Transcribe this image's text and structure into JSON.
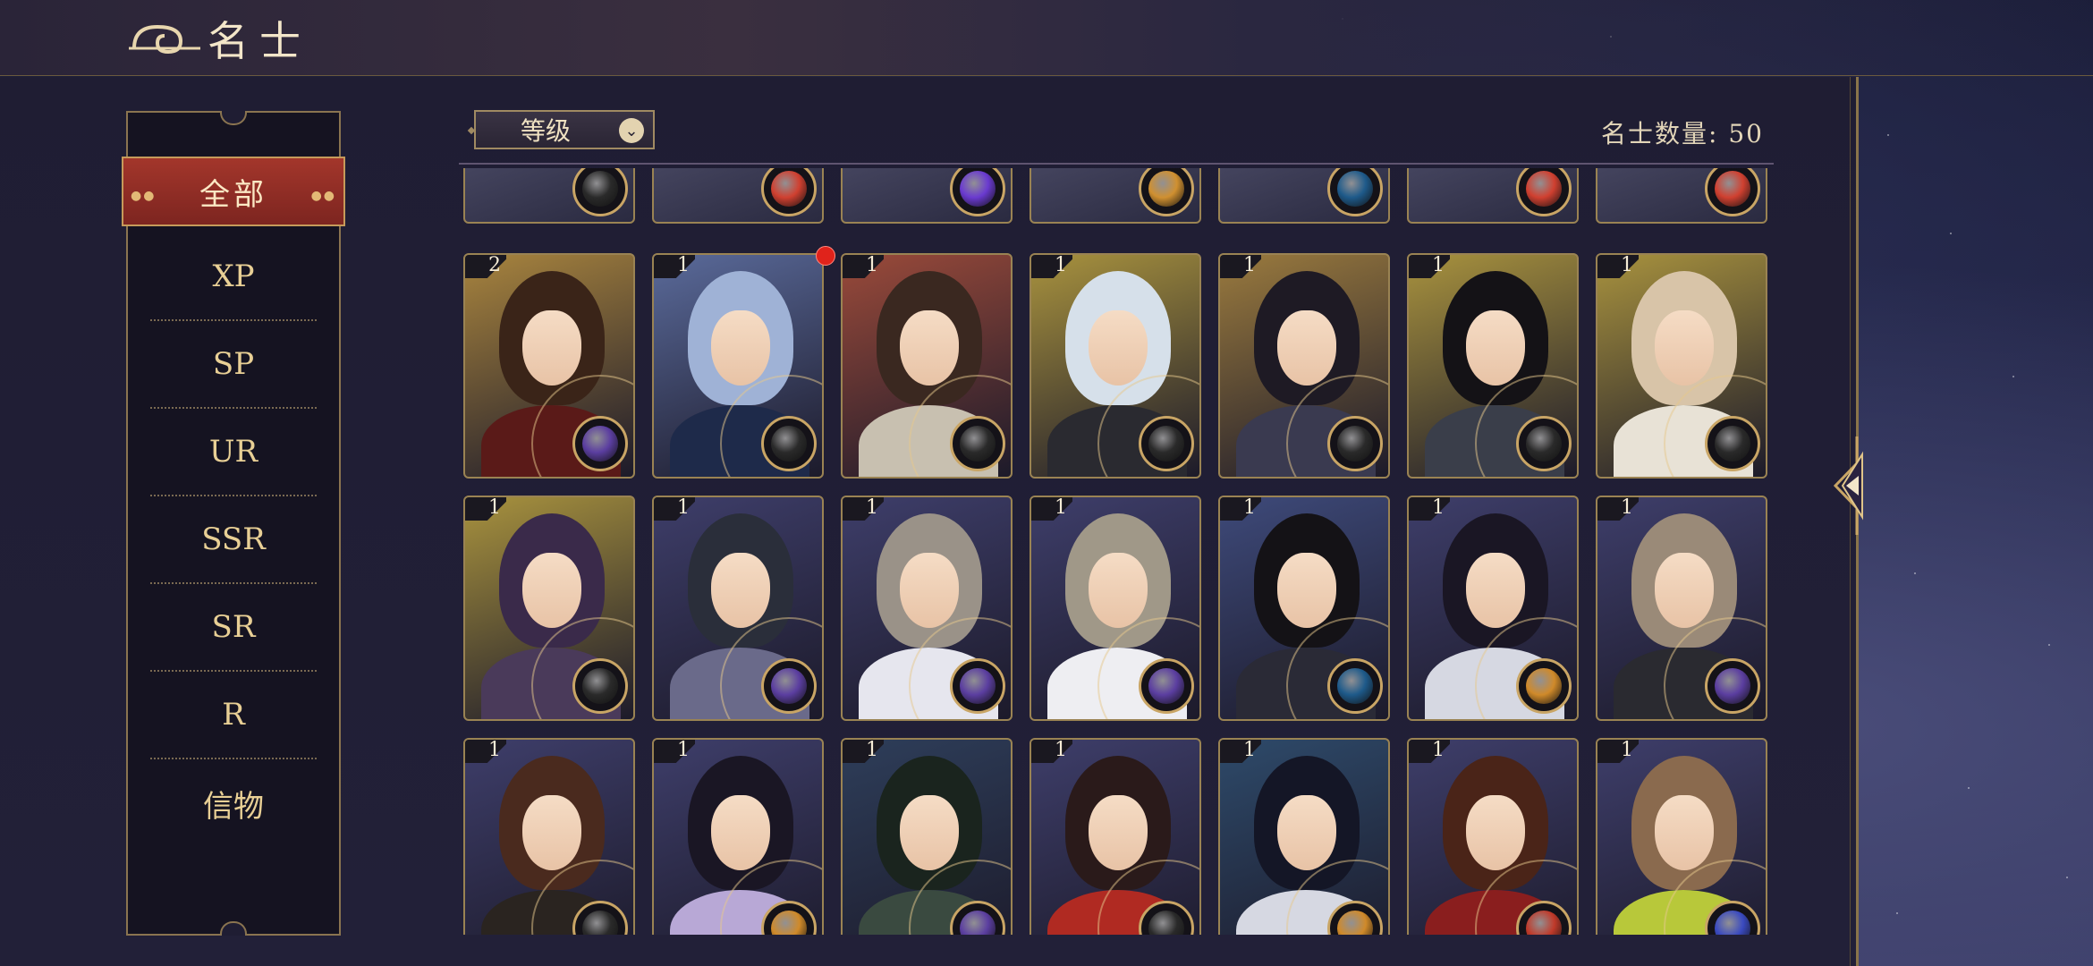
{
  "header": {
    "title": "名士"
  },
  "sidebar": {
    "active": "全部",
    "items": [
      "XP",
      "SP",
      "UR",
      "SSR",
      "SR",
      "R",
      "信物"
    ]
  },
  "toolbar": {
    "sort_label": "等级",
    "count_label": "名士数量: 50"
  },
  "cards": {
    "top_row_badges": [
      "compass",
      "red-orb",
      "purple-orb",
      "gold-orb",
      "blue-compass",
      "red-orb",
      "red-orb"
    ],
    "row1": [
      {
        "level": "2",
        "bg": "#a8843e",
        "hair": "#3a2418",
        "body": "#5a1a18",
        "badge": "purple"
      },
      {
        "level": "1",
        "bg": "#5a6a9a",
        "hair": "#9fb2d6",
        "body": "#1e2a4a",
        "badge": "compass-red"
      },
      {
        "level": "1",
        "bg": "#9a4a3a",
        "hair": "#3a2820",
        "body": "#c8c0b0",
        "badge": "compass-red"
      },
      {
        "level": "1",
        "bg": "#a8923e",
        "hair": "#d6e0ea",
        "body": "#2a2a30",
        "badge": "compass"
      },
      {
        "level": "1",
        "bg": "#9a7a3e",
        "hair": "#1e1a24",
        "body": "#3a3a50",
        "badge": "compass"
      },
      {
        "level": "1",
        "bg": "#a8923e",
        "hair": "#141216",
        "body": "#3a3e4a",
        "badge": "compass"
      },
      {
        "level": "1",
        "bg": "#a8923e",
        "hair": "#d8c4a8",
        "body": "#e8e2d6",
        "badge": "compass"
      }
    ],
    "row2": [
      {
        "level": "1",
        "bg": "#a8923e",
        "hair": "#3a2a4a",
        "body": "#4a3a5a",
        "badge": "compass"
      },
      {
        "level": "1",
        "bg": "#3e3e6a",
        "hair": "#2a2e3a",
        "body": "#6a6a8a",
        "badge": "purple"
      },
      {
        "level": "1",
        "bg": "#3e3e6a",
        "hair": "#9a9288",
        "body": "#e6e6ee",
        "badge": "purple"
      },
      {
        "level": "1",
        "bg": "#3e3e6a",
        "hair": "#a09888",
        "body": "#eeeef2",
        "badge": "purple"
      },
      {
        "level": "1",
        "bg": "#3e4a7a",
        "hair": "#141216",
        "body": "#2a2a36",
        "badge": "blue"
      },
      {
        "level": "1",
        "bg": "#3e3e6a",
        "hair": "#1a1624",
        "body": "#d6d8e2",
        "badge": "gold"
      },
      {
        "level": "1",
        "bg": "#3e3e6a",
        "hair": "#9a8a78",
        "body": "#2a2a30",
        "badge": "purple"
      }
    ],
    "row3": [
      {
        "level": "1",
        "bg": "#3e3e6a",
        "hair": "#4a2a1e",
        "body": "#2a2420",
        "badge": "compass"
      },
      {
        "level": "1",
        "bg": "#3e3e6a",
        "hair": "#1a1624",
        "body": "#b8a8d6",
        "badge": "gold"
      },
      {
        "level": "1",
        "bg": "#2e3e5a",
        "hair": "#1a241e",
        "body": "#3a4a40",
        "badge": "purple"
      },
      {
        "level": "1",
        "bg": "#3e3e6a",
        "hair": "#2a1a1a",
        "body": "#b02a22",
        "badge": "compass"
      },
      {
        "level": "1",
        "bg": "#2e4a6a",
        "hair": "#141626",
        "body": "#d6d8e2",
        "badge": "gold"
      },
      {
        "level": "1",
        "bg": "#3e3e6a",
        "hair": "#4a2418",
        "body": "#8a1e1e",
        "badge": "red"
      },
      {
        "level": "1",
        "bg": "#3e3e6a",
        "hair": "#8a6a4e",
        "body": "#b8c83a",
        "badge": "blue-orb"
      }
    ]
  },
  "colors": {
    "accent_red": "#a3362b",
    "gold": "#c9a565",
    "badge": {
      "compass": "#2a2a2a",
      "compass-red": "#2a2a2a",
      "purple": "#5b3ea0",
      "gold": "#d08a2a",
      "blue": "#1e5a8a",
      "red": "#c03a2a",
      "blue-orb": "#3a4ac0",
      "red-orb": "#d04030",
      "purple-orb": "#6a3ad0",
      "gold-orb": "#d09030",
      "blue-compass": "#1e5a8a"
    }
  }
}
